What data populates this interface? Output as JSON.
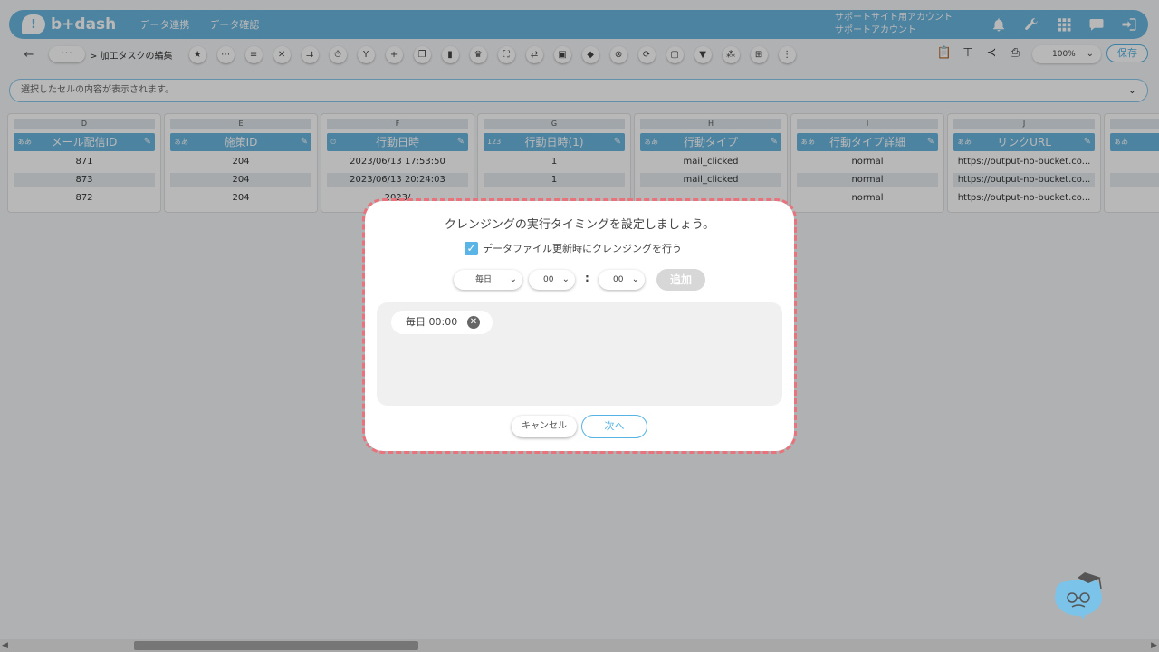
{
  "app": {
    "brand": "b+dash",
    "nav": [
      "データ連携",
      "データ確認"
    ],
    "account_lines": [
      "サポートサイト用アカウント",
      "サポートアカウント"
    ]
  },
  "toolbar": {
    "back": "←",
    "more": "···",
    "breadcrumb": "> 加工タスクの編集",
    "zoom": "100%",
    "save_label": "保存"
  },
  "cellbar": {
    "placeholder": "選択したセルの内容が表示されます。"
  },
  "columns": [
    {
      "letter": "D",
      "name": "メール配信ID",
      "type": "ぁあ",
      "cells": [
        "871",
        "873",
        "872"
      ]
    },
    {
      "letter": "E",
      "name": "施策ID",
      "type": "ぁあ",
      "cells": [
        "204",
        "204",
        "204"
      ]
    },
    {
      "letter": "F",
      "name": "行動日時",
      "type": "⏱",
      "cells": [
        "2023/06/13 17:53:50",
        "2023/06/13 20:24:03",
        "2023/"
      ]
    },
    {
      "letter": "G",
      "name": "行動日時(1)",
      "type": "123",
      "cells": [
        "1",
        "1",
        ""
      ]
    },
    {
      "letter": "H",
      "name": "行動タイプ",
      "type": "ぁあ",
      "cells": [
        "mail_clicked",
        "mail_clicked",
        ""
      ]
    },
    {
      "letter": "I",
      "name": "行動タイプ詳細",
      "type": "ぁあ",
      "cells": [
        "normal",
        "normal",
        "normal"
      ]
    },
    {
      "letter": "J",
      "name": "リンクURL",
      "type": "ぁあ",
      "cells": [
        "https://output-no-bucket.co...",
        "https://output-no-bucket.co...",
        "https://output-no-bucket.co..."
      ]
    },
    {
      "letter": "",
      "name": "",
      "type": "ぁあ",
      "cells": [
        "",
        "",
        ""
      ]
    }
  ],
  "modal": {
    "title": "クレンジングの実行タイミングを設定しましょう。",
    "checkbox_label": "データファイル更新時にクレンジングを行う",
    "checkbox_checked": true,
    "frequency": "毎日",
    "hour": "00",
    "minute": "00",
    "colon": ":",
    "add_label": "追加",
    "schedules": [
      "毎日 00:00"
    ],
    "cancel_label": "キャンセル",
    "next_label": "次へ"
  },
  "colors": {
    "accent": "#6ab6e0",
    "highlight_border": "#e9737c"
  }
}
